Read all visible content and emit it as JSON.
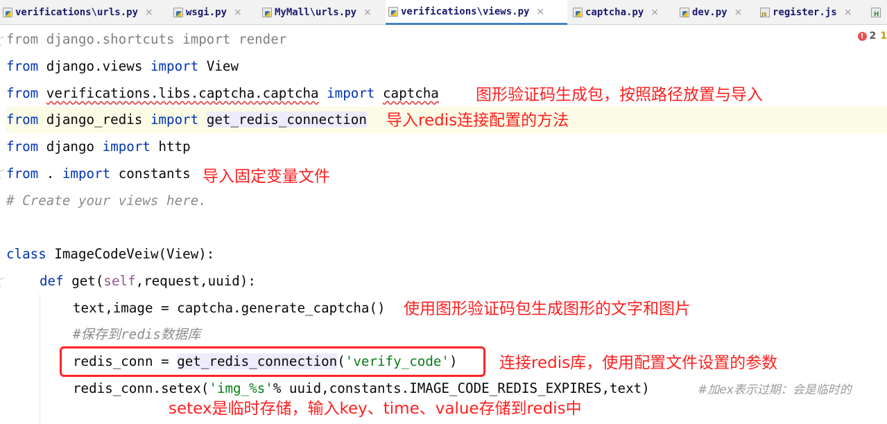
{
  "tabs": [
    {
      "label": "verifications\\urls.py",
      "close": "×",
      "icon": "python-file-icon"
    },
    {
      "label": "wsgi.py",
      "close": "×",
      "icon": "python-file-icon"
    },
    {
      "label": "MyMall\\urls.py",
      "close": "×",
      "icon": "python-file-icon"
    },
    {
      "label": "verifications\\views.py",
      "close": "×",
      "icon": "python-file-icon",
      "active": true
    },
    {
      "label": "captcha.py",
      "close": "×",
      "icon": "python-file-icon"
    },
    {
      "label": "dev.py",
      "close": "×",
      "icon": "python-file-icon"
    },
    {
      "label": "register.js",
      "close": "×",
      "icon": "javascript-file-icon"
    },
    {
      "label": "",
      "icon": "html-file-icon"
    }
  ],
  "inspections": {
    "errors": "2",
    "warnings": "1"
  },
  "code": {
    "l1": {
      "from": "from",
      "rest": " django.shortcuts import render"
    },
    "l2": {
      "from": "from",
      "mod": " django.views ",
      "imp": "import",
      "name": " View"
    },
    "l3": {
      "from": "from",
      "mod": "verifications.libs.captcha.captcha",
      "imp": "import",
      "name": "captcha"
    },
    "l4": {
      "from": "from",
      "mod": " django_redis ",
      "imp": "import",
      "name": "get_redis_connection"
    },
    "l5": {
      "from": "from",
      "mod": " django ",
      "imp": "import",
      "name": " http"
    },
    "l6": {
      "from": "from",
      "mod": " . ",
      "imp": "import",
      "name": " constants"
    },
    "l7": {
      "comment": "# Create your views here."
    },
    "l9": {
      "cls": "class",
      "rest": " ImageCodeVeiw(View):"
    },
    "l10": {
      "def": "def",
      "fn": " get(",
      "self": "self",
      "rest": ",request,uuid):"
    },
    "l11": {
      "text": "text,image = captcha.generate_captcha()"
    },
    "l12": {
      "comment": "#保存到redis数据库"
    },
    "l13": {
      "pre": "redis_conn = ",
      "fn": "get_redis_connection",
      "open": "(",
      "str": "'verify_code'",
      "close": ")"
    },
    "l14": {
      "pre": "redis_conn.setex(",
      "str": "'img_%s'",
      "rest": "% uuid,constants.IMAGE_CODE_REDIS_EXPIRES,text)",
      "comment": "#加ex表示过期：会是临时的"
    }
  },
  "annotations": {
    "a3": "图形验证码生成包，按照路径放置与导入",
    "a4": "导入redis连接配置的方法",
    "a6": "导入固定变量文件",
    "a11": "使用图形验证码包生成图形的文字和图片",
    "a13": "连接redis库，使用配置文件设置的参数",
    "a15": "setex是临时存储，输入key、time、value存储到redis中"
  },
  "colors": {
    "keyword": "#0033b3",
    "string": "#067d17",
    "comment": "#8c8c8c",
    "annotation": "#ff1f1f",
    "active_tab_underline": "#4083c9"
  }
}
